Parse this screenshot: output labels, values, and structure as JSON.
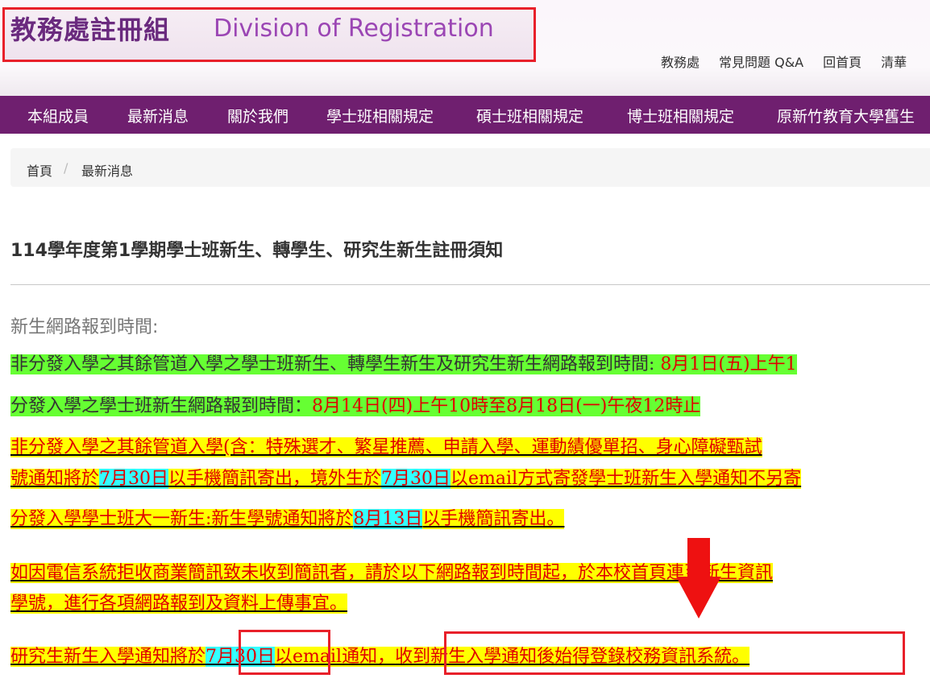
{
  "header": {
    "title_cn": "教務處註冊組",
    "title_en": "Division of Registration",
    "links": [
      "教務處",
      "常見問題 Q&A",
      "回首頁",
      "清華"
    ]
  },
  "nav": {
    "items": [
      "本組成員",
      "最新消息",
      "關於我們",
      "學士班相關規定",
      "碩士班相關規定",
      "博士班相關規定",
      "原新竹教育大學舊生"
    ]
  },
  "breadcrumb": {
    "home": "首頁",
    "separator": "/",
    "current": "最新消息"
  },
  "article": {
    "title": "114學年度第1學期學士班新生、轉學生、研究生新生註冊須知",
    "section_label": "新生網路報到時間:",
    "line1": {
      "text": "非分發入學之其餘管道入學之學士班新生、轉學生新生及研究生新生網路報到時間: ",
      "date": "8月1日(五)上午1"
    },
    "line2": {
      "text": "分發入學之學士班新生網路報到時間：",
      "date": "8月14日(四)上午10時至8月18日(一)午夜12時止"
    },
    "line3": "非分發入學之其餘管道入學(含：特殊選才、繁星推薦、申請入學、運動績優單招、身心障礙甄試",
    "line4": {
      "a": "號通知將於",
      "d1": "7月30日",
      "b": "以手機簡訊寄出，境外生於",
      "d2": "7月30日",
      "c": "以email方式寄發學士班新生入學通知不另寄"
    },
    "line5": {
      "a": "分發入學學士班大一新生:新生學號通知將於",
      "d": "8月13日",
      "b": "以手機簡訊寄出。"
    },
    "line6": "如因電信系統拒收商業簡訊致未收到簡訊者，請於以下網路報到時間起，於本校首頁連至新生資訊",
    "line7": "學號，進行各項網路報到及資料上傳事宜。",
    "line8": {
      "a": "研究生新生入學通知將於",
      "d": "7月30日",
      "b": "以email通知，",
      "c": "收到新生入學通知後始得登錄校務資訊系統。"
    }
  },
  "colors": {
    "brand_purple": "#6f1f6f",
    "highlight_green": "#66ff33",
    "highlight_yellow": "#ffff00",
    "highlight_cyan": "#33ffff",
    "emphasis_red": "#e00000",
    "annotation_red": "#e8202a"
  }
}
